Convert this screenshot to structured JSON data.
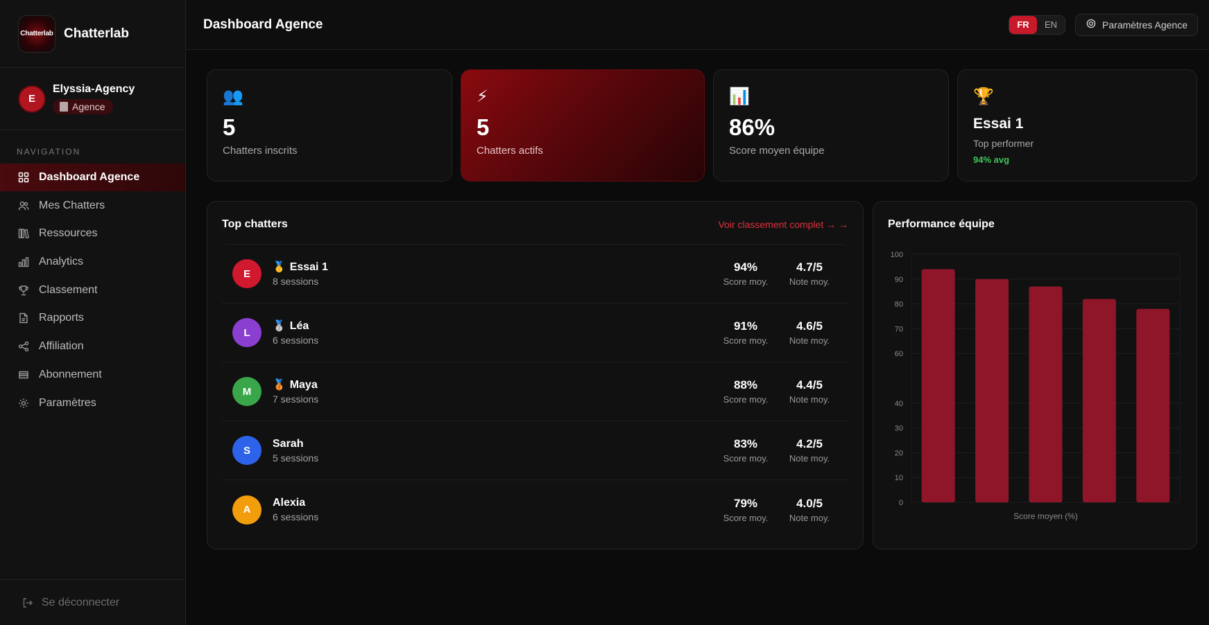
{
  "brand": {
    "logo_text": "Chatterlab",
    "name": "Chatterlab"
  },
  "agency": {
    "initial": "E",
    "name": "Elyssia-Agency",
    "badge": "Agence"
  },
  "nav": {
    "title": "NAVIGATION",
    "items": [
      {
        "label": "Dashboard Agence",
        "icon": "grid-icon"
      },
      {
        "label": "Mes Chatters",
        "icon": "users-icon"
      },
      {
        "label": "Ressources",
        "icon": "library-icon"
      },
      {
        "label": "Analytics",
        "icon": "bar-chart-icon"
      },
      {
        "label": "Classement",
        "icon": "trophy-icon"
      },
      {
        "label": "Rapports",
        "icon": "file-icon"
      },
      {
        "label": "Affiliation",
        "icon": "share-icon"
      },
      {
        "label": "Abonnement",
        "icon": "card-icon"
      },
      {
        "label": "Paramètres",
        "icon": "gear-icon"
      }
    ],
    "logout": "Se déconnecter"
  },
  "header": {
    "title": "Dashboard Agence",
    "lang_fr": "FR",
    "lang_en": "EN",
    "selected_lang": "FR",
    "settings": "Paramètres Agence"
  },
  "stats": {
    "registered": {
      "emoji": "👥",
      "value": "5",
      "label": "Chatters inscrits"
    },
    "active": {
      "emoji": "⚡",
      "value": "5",
      "label": "Chatters actifs"
    },
    "score": {
      "emoji": "📊",
      "value": "86%",
      "label": "Score moyen équipe"
    },
    "top": {
      "emoji": "🏆",
      "name": "Essai 1",
      "label": "Top performer",
      "avg": "94% avg"
    }
  },
  "top_chatters": {
    "title": "Top chatters",
    "link": "Voir classement complet → →",
    "score_label": "Score moy.",
    "note_label": "Note moy.",
    "rows": [
      {
        "initial": "E",
        "color": "#d0182e",
        "medal": "🥇",
        "name": "Essai 1",
        "sessions": "8 sessions",
        "score": "94%",
        "note": "4.7/5"
      },
      {
        "initial": "L",
        "color": "#8a3fd1",
        "medal": "🥈",
        "name": "Léa",
        "sessions": "6 sessions",
        "score": "91%",
        "note": "4.6/5"
      },
      {
        "initial": "M",
        "color": "#3aa64a",
        "medal": "🥉",
        "name": "Maya",
        "sessions": "7 sessions",
        "score": "88%",
        "note": "4.4/5"
      },
      {
        "initial": "S",
        "color": "#2d63e8",
        "medal": "",
        "name": "Sarah",
        "sessions": "5 sessions",
        "score": "83%",
        "note": "4.2/5"
      },
      {
        "initial": "A",
        "color": "#f29d0c",
        "medal": "",
        "name": "Alexia",
        "sessions": "6 sessions",
        "score": "79%",
        "note": "4.0/5"
      }
    ]
  },
  "performance": {
    "title": "Performance équipe"
  },
  "chart_data": {
    "type": "bar",
    "title": "Performance équipe",
    "xlabel": "Score moyen (%)",
    "ylabel": "",
    "categories": [
      "",
      "",
      "",
      "",
      ""
    ],
    "values": [
      94,
      90,
      87,
      82,
      78
    ],
    "yticks": [
      "0",
      "10",
      "20",
      "30",
      "40",
      "60",
      "70",
      "80",
      "90",
      "100"
    ],
    "ylim": [
      0,
      100
    ],
    "grid": true,
    "bar_color": "#8e1628"
  },
  "colors": {
    "accent": "#c8192a",
    "success": "#3fc55b",
    "link": "#e0303c"
  }
}
